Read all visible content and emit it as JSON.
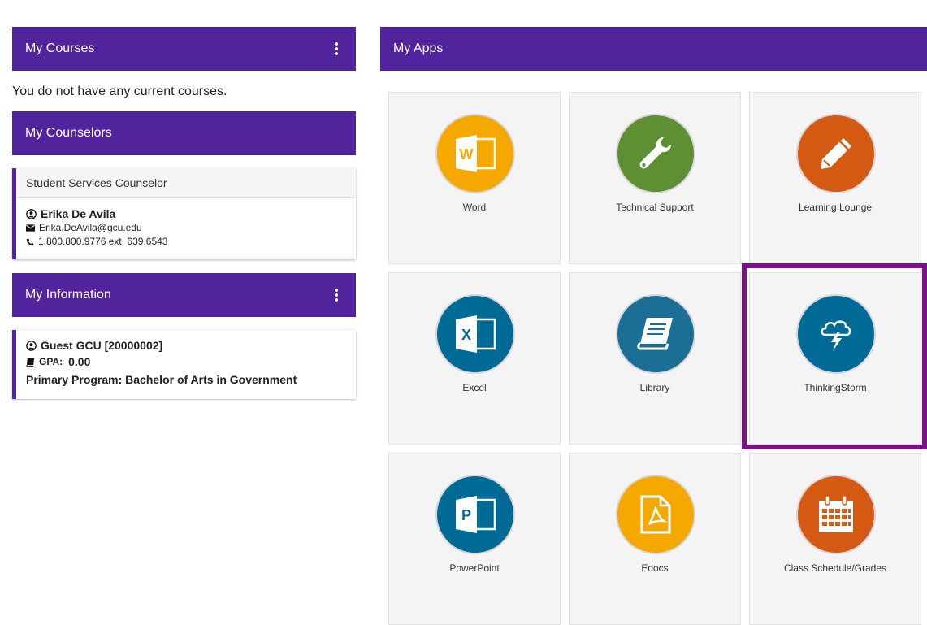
{
  "courses": {
    "title": "My Courses",
    "empty_text": "You do not have any current courses."
  },
  "counselors": {
    "title": "My Counselors",
    "card": {
      "role": "Student Services Counselor",
      "name": "Erika De Avila",
      "email": "Erika.DeAvila@gcu.edu",
      "phone": "1.800.800.9776 ext. 639.6543"
    }
  },
  "information": {
    "title": "My Information",
    "card": {
      "name": "Guest GCU [20000002]",
      "gpa_label": "GPA:",
      "gpa_value": "0.00",
      "program": "Primary Program: Bachelor of Arts in Government"
    }
  },
  "apps": {
    "title": "My Apps",
    "tiles": [
      {
        "label": "Word",
        "icon": "word-icon",
        "color": "#f5a800",
        "letter": "W"
      },
      {
        "label": "Technical Support",
        "icon": "wrench-icon",
        "color": "#5e8f33"
      },
      {
        "label": "Learning Lounge",
        "icon": "pencil-icon",
        "color": "#d45a14"
      },
      {
        "label": "Excel",
        "icon": "excel-icon",
        "color": "#006a97",
        "letter": "X"
      },
      {
        "label": "Library",
        "icon": "book-icon",
        "color": "#1b6f96"
      },
      {
        "label": "ThinkingStorm",
        "icon": "storm-cloud-icon",
        "color": "#006a97"
      },
      {
        "label": "PowerPoint",
        "icon": "powerpoint-icon",
        "color": "#006a97",
        "letter": "P"
      },
      {
        "label": "Edocs",
        "icon": "pdf-icon",
        "color": "#f5a800"
      },
      {
        "label": "Class Schedule/Grades",
        "icon": "calendar-icon",
        "color": "#d45a14"
      }
    ]
  }
}
